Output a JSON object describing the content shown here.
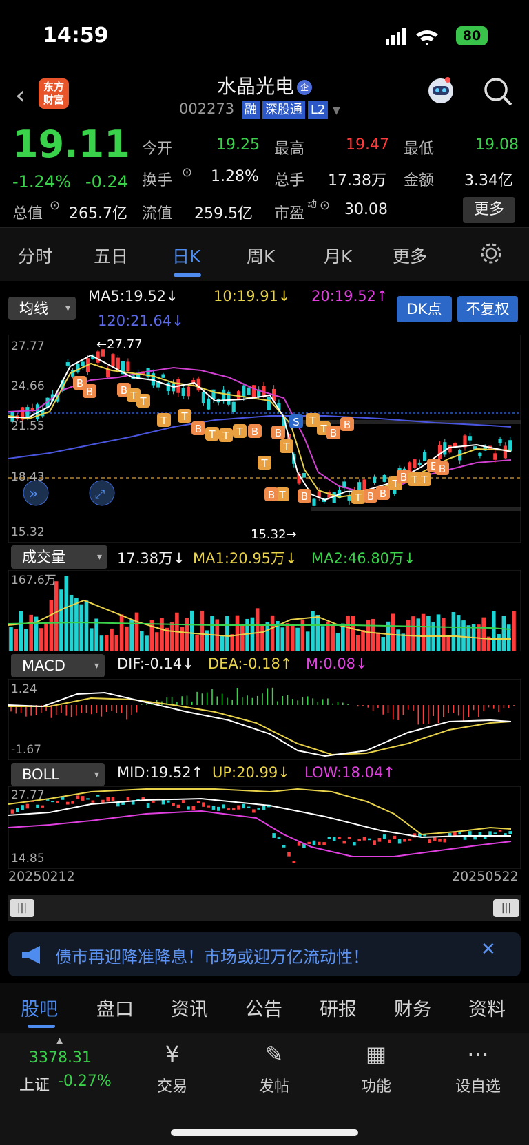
{
  "status": {
    "time": "14:59",
    "battery": "80"
  },
  "header": {
    "back": "‹",
    "logo": "东方财富",
    "name": "水晶光电",
    "badge": "企",
    "code": "002273",
    "tags": [
      "融",
      "深股通",
      "L2"
    ]
  },
  "quote": {
    "price": "19.11",
    "pct": "-1.24%",
    "chg": "-0.24",
    "open_label": "今开",
    "open": "19.25",
    "high_label": "最高",
    "high": "19.47",
    "low_label": "最低",
    "low": "19.08",
    "turnover_label": "换手",
    "turnover": "1.28%",
    "vol_label": "总手",
    "vol": "17.38万",
    "amt_label": "金额",
    "amt": "3.34亿",
    "mcap_label": "总值",
    "mcap": "265.7亿",
    "float_label": "流值",
    "float": "259.5亿",
    "pe_label": "市盈",
    "pe_sup": "动",
    "pe": "30.08",
    "more": "更多"
  },
  "tabs": [
    "分时",
    "五日",
    "日K",
    "周K",
    "月K",
    "更多"
  ],
  "ma": {
    "select": "均线",
    "ma5": "MA5:19.52↓",
    "ma10": "10:19.91↓",
    "ma20": "20:19.52↑",
    "ma120": "120:21.64↓",
    "dk": "DK点",
    "fq": "不复权"
  },
  "kline": {
    "y_top": "27.77",
    "y2": "24.66",
    "y3": "21.55",
    "y4": "18.43",
    "y_bot": "15.32",
    "hi_label": "←27.77",
    "lo_label": "15.32→"
  },
  "vol": {
    "select": "成交量",
    "v": "17.38万↓",
    "ma1": "MA1:20.95万↓",
    "ma2": "MA2:46.80万↓",
    "ymax": "167.6万"
  },
  "macd": {
    "select": "MACD",
    "dif": "DIF:-0.14↓",
    "dea": "DEA:-0.18↑",
    "m": "M:0.08↓",
    "ytop": "1.24",
    "ybot": "-1.67"
  },
  "boll": {
    "select": "BOLL",
    "mid": "MID:19.52↑",
    "up": "UP:20.99↓",
    "low": "LOW:18.04↑",
    "ytop": "27.77",
    "ybot": "14.85"
  },
  "dates": {
    "start": "20250212",
    "end": "20250522"
  },
  "ad": {
    "text": "债市再迎降准降息！市场或迎万亿流动性！"
  },
  "tabs2": [
    "股吧",
    "盘口",
    "资讯",
    "公告",
    "研报",
    "财务",
    "资料"
  ],
  "bottom": {
    "index_val": "3378.31",
    "index_name": "上证",
    "index_pct": "-0.27%",
    "items": [
      "交易",
      "发帖",
      "功能",
      "设自选"
    ]
  },
  "colors": {
    "up": "#ff3c3c",
    "down": "#21d4d4",
    "fall_text": "#3bd24b",
    "accent": "#4f8cf0"
  }
}
